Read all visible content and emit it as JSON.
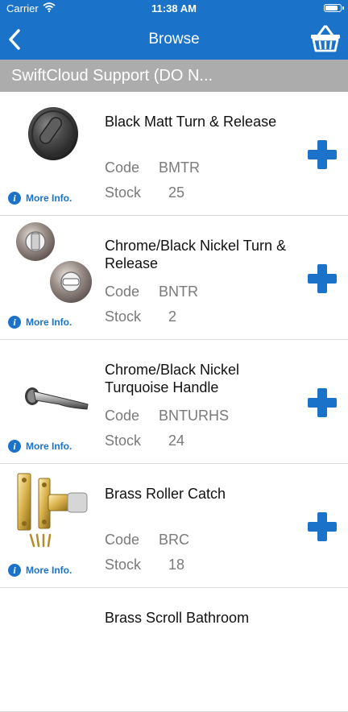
{
  "status": {
    "carrier": "Carrier",
    "time": "11:38 AM"
  },
  "nav": {
    "title": "Browse",
    "back_icon": "chevron-left-icon",
    "basket_icon": "basket-icon"
  },
  "section": {
    "title": "SwiftCloud Support (DO N..."
  },
  "labels": {
    "more_info": "More Info.",
    "code": "Code",
    "stock": "Stock"
  },
  "colors": {
    "accent": "#1a73c9",
    "section_bar": "#acacac"
  },
  "products": [
    {
      "name": "Black Matt Turn & Release",
      "code": "BMTR",
      "stock": "25",
      "image": "black-turn-release-image"
    },
    {
      "name": "Chrome/Black Nickel Turn & Release",
      "code": "BNTR",
      "stock": "2",
      "image": "nickel-turn-release-image"
    },
    {
      "name": "Chrome/Black Nickel Turquoise Handle",
      "code": "BNTURHS",
      "stock": "24",
      "image": "lever-handle-image"
    },
    {
      "name": "Brass Roller Catch",
      "code": "BRC",
      "stock": "18",
      "image": "roller-catch-image"
    },
    {
      "name": "Brass Scroll Bathroom",
      "code": "",
      "stock": "",
      "image": ""
    }
  ]
}
